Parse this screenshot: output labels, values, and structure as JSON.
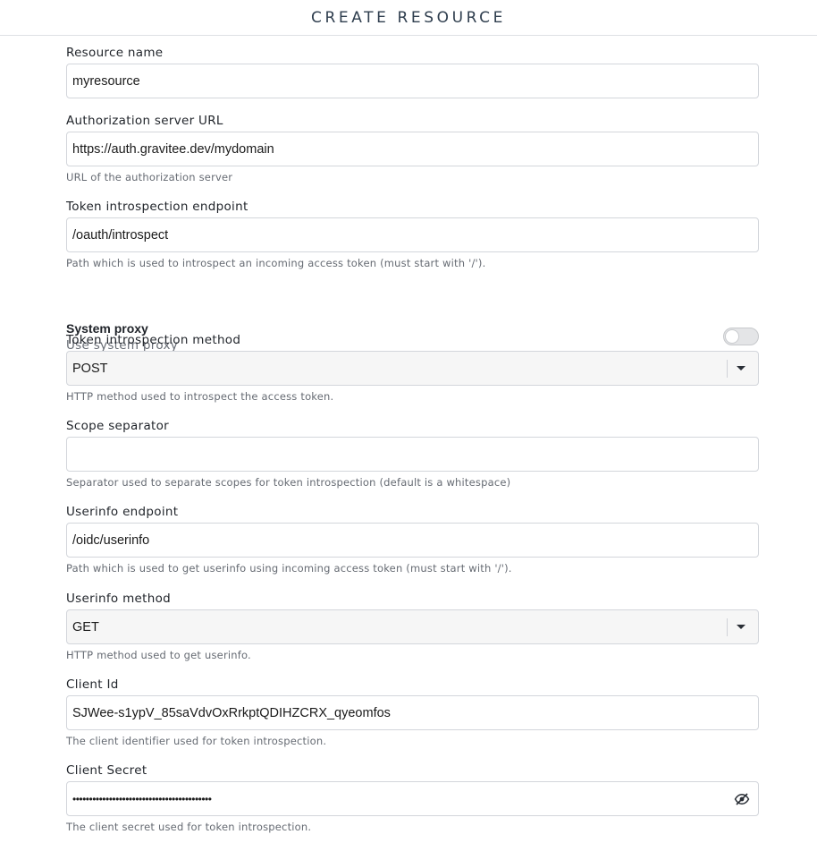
{
  "header": {
    "title": "CREATE RESOURCE"
  },
  "fields": {
    "resource_name": {
      "label": "Resource name",
      "value": "myresource"
    },
    "auth_server_url": {
      "label": "Authorization server URL",
      "value": "https://auth.gravitee.dev/mydomain",
      "help": "URL of the authorization server"
    },
    "introspection_endpoint": {
      "label": "Token introspection endpoint",
      "value": "/oauth/introspect",
      "help": "Path which is used to introspect an incoming access token (must start with '/')."
    },
    "system_proxy": {
      "title": "System proxy",
      "subtitle": "Use system proxy",
      "enabled": false
    },
    "introspection_method": {
      "label": "Token introspection method",
      "value": "POST",
      "help": "HTTP method used to introspect the access token."
    },
    "scope_separator": {
      "label": "Scope separator",
      "value": "",
      "help": "Separator used to separate scopes for token introspection (default is a whitespace)"
    },
    "userinfo_endpoint": {
      "label": "Userinfo endpoint",
      "value": "/oidc/userinfo",
      "help": "Path which is used to get userinfo using incoming access token (must start with '/')."
    },
    "userinfo_method": {
      "label": "Userinfo method",
      "value": "GET",
      "help": "HTTP method used to get userinfo."
    },
    "client_id": {
      "label": "Client Id",
      "value": "SJWee-s1ypV_85saVdvOxRrkptQDIHZCRX_qyeomfos",
      "help": "The client identifier used for token introspection."
    },
    "client_secret": {
      "label": "Client Secret",
      "value": "••••••••••••••••••••••••••••••••••••••••••",
      "help": "The client secret used for token introspection.",
      "icon": "eye-off-icon"
    }
  }
}
